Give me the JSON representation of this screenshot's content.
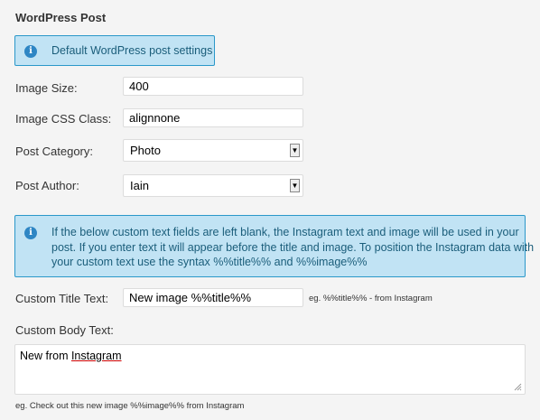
{
  "section": {
    "title": "WordPress Post"
  },
  "info_default": {
    "text": "Default WordPress post settings"
  },
  "fields": {
    "image_size": {
      "label": "Image Size:",
      "value": "400"
    },
    "image_css_class": {
      "label": "Image CSS Class:",
      "value": "alignnone"
    },
    "post_category": {
      "label": "Post Category:",
      "value": "Photo"
    },
    "post_author": {
      "label": "Post Author:",
      "value": "Iain"
    }
  },
  "info_custom": {
    "line1": "If the below custom text fields are left blank, the Instagram text and image will be used in your",
    "line2": "post. If you enter text it will appear before the title and image. To position the Instagram data with",
    "line3": "your custom text use the syntax %%title%% and %%image%%"
  },
  "custom_title": {
    "label": "Custom Title Text:",
    "value": "New image %%title%%",
    "hint": "eg. %%title%% - from Instagram"
  },
  "custom_body": {
    "label": "Custom Body Text:",
    "value_prefix": "New from ",
    "value_word": "Instagram",
    "hint": "eg. Check out this new image %%image%% from Instagram"
  }
}
